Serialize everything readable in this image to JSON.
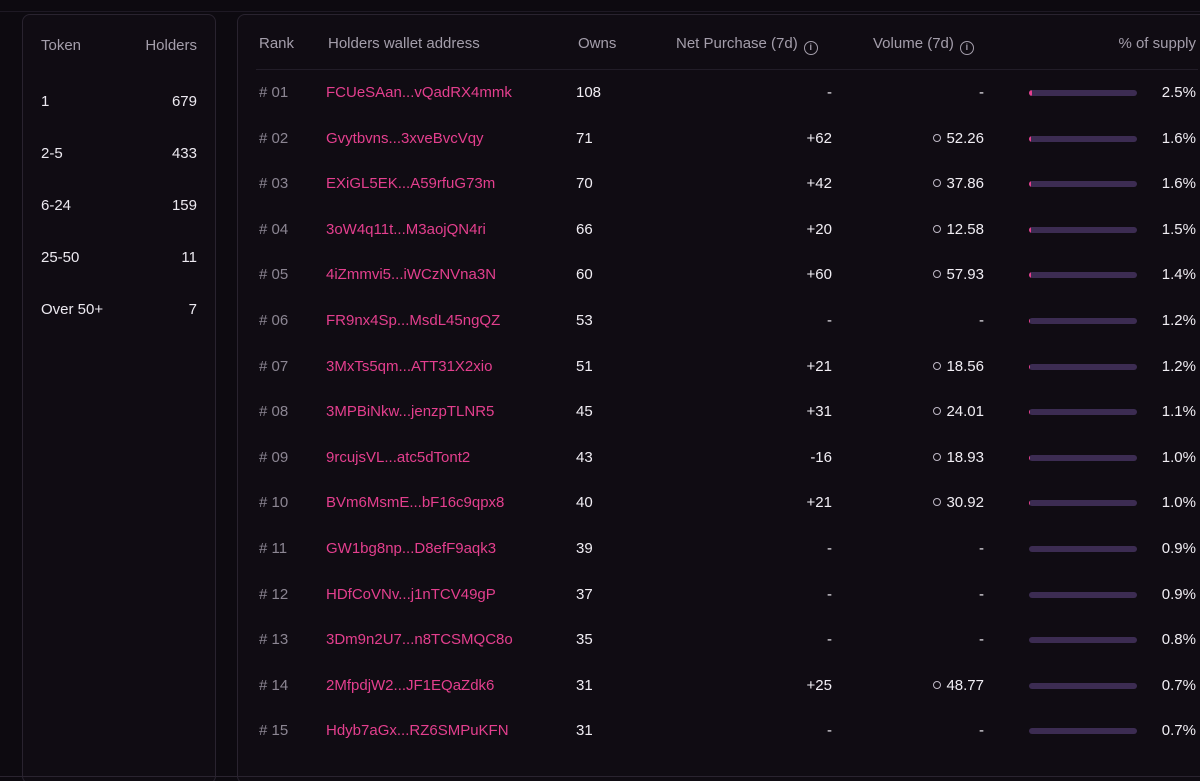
{
  "distribution": {
    "headers": {
      "token": "Token",
      "holders": "Holders"
    },
    "rows": [
      {
        "token": "1",
        "holders": "679"
      },
      {
        "token": "2-5",
        "holders": "433"
      },
      {
        "token": "6-24",
        "holders": "159"
      },
      {
        "token": "25-50",
        "holders": "11"
      },
      {
        "token": "Over 50+",
        "holders": "7"
      }
    ]
  },
  "holders": {
    "headers": {
      "rank": "Rank",
      "address": "Holders wallet address",
      "owns": "Owns",
      "net_purchase": "Net Purchase (7d)",
      "volume": "Volume (7d)",
      "supply": "% of supply"
    },
    "info_icon": "info-circle-icon",
    "volume_icon": "sol-coin-icon",
    "colors": {
      "accent": "#e43f8e",
      "bar_track": "#3c2c52",
      "background": "#0d0a10"
    },
    "rows": [
      {
        "rank": "# 01",
        "address": "FCUeSAan...vQadRX4mmk",
        "owns": "108",
        "net": "-",
        "volume": "-",
        "pct": "2.5%",
        "fill": 0.03
      },
      {
        "rank": "# 02",
        "address": "Gvytbvns...3xveBvcVqy",
        "owns": "71",
        "net": "+62",
        "volume": "52.26",
        "pct": "1.6%",
        "fill": 0.02
      },
      {
        "rank": "# 03",
        "address": "EXiGL5EK...A59rfuG73m",
        "owns": "70",
        "net": "+42",
        "volume": "37.86",
        "pct": "1.6%",
        "fill": 0.02
      },
      {
        "rank": "# 04",
        "address": "3oW4q11t...M3aojQN4ri",
        "owns": "66",
        "net": "+20",
        "volume": "12.58",
        "pct": "1.5%",
        "fill": 0.02
      },
      {
        "rank": "# 05",
        "address": "4iZmmvi5...iWCzNVna3N",
        "owns": "60",
        "net": "+60",
        "volume": "57.93",
        "pct": "1.4%",
        "fill": 0.02
      },
      {
        "rank": "# 06",
        "address": "FR9nx4Sp...MsdL45ngQZ",
        "owns": "53",
        "net": "-",
        "volume": "-",
        "pct": "1.2%",
        "fill": 0.01
      },
      {
        "rank": "# 07",
        "address": "3MxTs5qm...ATT31X2xio",
        "owns": "51",
        "net": "+21",
        "volume": "18.56",
        "pct": "1.2%",
        "fill": 0.01
      },
      {
        "rank": "# 08",
        "address": "3MPBiNkw...jenzpTLNR5",
        "owns": "45",
        "net": "+31",
        "volume": "24.01",
        "pct": "1.1%",
        "fill": 0.01
      },
      {
        "rank": "# 09",
        "address": "9rcujsVL...atc5dTont2",
        "owns": "43",
        "net": "-16",
        "volume": "18.93",
        "pct": "1.0%",
        "fill": 0.01
      },
      {
        "rank": "# 10",
        "address": "BVm6MsmE...bF16c9qpx8",
        "owns": "40",
        "net": "+21",
        "volume": "30.92",
        "pct": "1.0%",
        "fill": 0.01
      },
      {
        "rank": "# 11",
        "address": "GW1bg8np...D8efF9aqk3",
        "owns": "39",
        "net": "-",
        "volume": "-",
        "pct": "0.9%",
        "fill": 0.0
      },
      {
        "rank": "# 12",
        "address": "HDfCoVNv...j1nTCV49gP",
        "owns": "37",
        "net": "-",
        "volume": "-",
        "pct": "0.9%",
        "fill": 0.0
      },
      {
        "rank": "# 13",
        "address": "3Dm9n2U7...n8TCSMQC8o",
        "owns": "35",
        "net": "-",
        "volume": "-",
        "pct": "0.8%",
        "fill": 0.0
      },
      {
        "rank": "# 14",
        "address": "2MfpdjW2...JF1EQaZdk6",
        "owns": "31",
        "net": "+25",
        "volume": "48.77",
        "pct": "0.7%",
        "fill": 0.0
      },
      {
        "rank": "# 15",
        "address": "Hdyb7aGx...RZ6SMPuKFN",
        "owns": "31",
        "net": "-",
        "volume": "-",
        "pct": "0.7%",
        "fill": 0.0
      }
    ]
  }
}
